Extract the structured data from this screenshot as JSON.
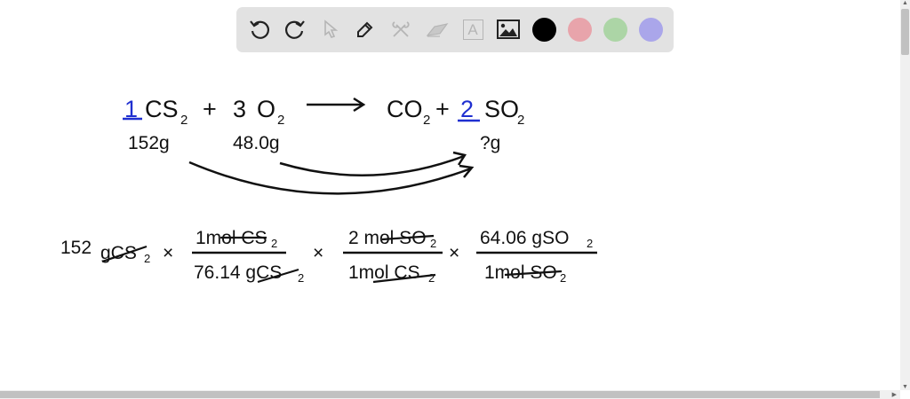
{
  "toolbar": {
    "tools": [
      "undo-icon",
      "redo-icon",
      "select-icon",
      "pen-icon",
      "tools-icon",
      "eraser-icon",
      "text-icon",
      "image-icon"
    ],
    "text_tool_label": "A",
    "colors": {
      "black": "#000000",
      "pink": "#e8a4ab",
      "green": "#acd5a6",
      "purple": "#aaa6ea"
    }
  },
  "equation": {
    "coef_cs2": "1",
    "cs2": "CS",
    "cs2_sub": "2",
    "plus1": "+",
    "coef_o2": "3",
    "o2": "O",
    "o2_sub": "2",
    "co2": "CO",
    "co2_sub": "2",
    "plus2": "+",
    "coef_so2": "2",
    "so2": "SO",
    "so2_sub": "2",
    "mass_cs2": "152g",
    "mass_o2": "48.0g",
    "mass_so2": "?g"
  },
  "calculation": {
    "start": "152",
    "start_unit": "gCS",
    "start_sub": "2",
    "times": "×",
    "f1_num": "1mol CS",
    "f1_num_sub": "2",
    "f1_den": "76.14 gCS",
    "f1_den_sub": "2",
    "f2_num": "2 mol SO",
    "f2_num_sub": "2",
    "f2_den": "1mol CS",
    "f2_den_sub": "2",
    "f3_num": "64.06 gSO",
    "f3_num_sub": "2",
    "f3_den": "1mol SO",
    "f3_den_sub": "2"
  }
}
